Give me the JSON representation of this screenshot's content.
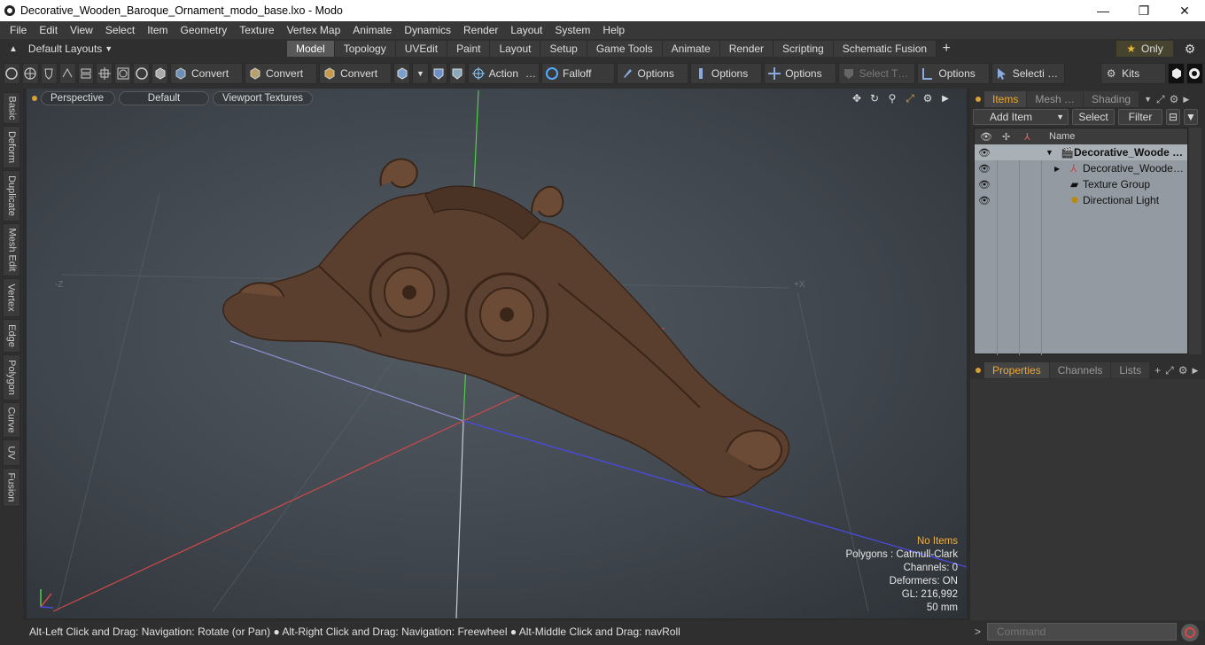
{
  "window": {
    "title": "Decorative_Wooden_Baroque_Ornament_modo_base.lxo - Modo",
    "minimize": "—",
    "maximize": "❐",
    "close": "✕"
  },
  "menu": [
    "File",
    "Edit",
    "View",
    "Select",
    "Item",
    "Geometry",
    "Texture",
    "Vertex Map",
    "Animate",
    "Dynamics",
    "Render",
    "Layout",
    "System",
    "Help"
  ],
  "layouts": {
    "label": "Default Layouts"
  },
  "tabs": [
    "Model",
    "Topology",
    "UVEdit",
    "Paint",
    "Layout",
    "Setup",
    "Game Tools",
    "Animate",
    "Render",
    "Scripting",
    "Schematic Fusion"
  ],
  "active_tab": "Model",
  "only_label": "Only",
  "toolbar": {
    "convert1": "Convert",
    "convert2": "Convert",
    "convert3": "Convert",
    "action": "Action",
    "action_more": "…",
    "falloff": "Falloff",
    "options1": "Options",
    "options2": "Options",
    "options3": "Options",
    "select_t": "Select T…",
    "options4": "Options",
    "selecti": "Selecti …",
    "kits": "Kits"
  },
  "left_tabs": [
    "Basic",
    "Deform",
    "Duplicate",
    "Mesh Edit",
    "Vertex",
    "Edge",
    "Polygon",
    "Curve",
    "UV",
    "Fusion"
  ],
  "viewport": {
    "view": "Perspective",
    "shading": "Default",
    "textures": "Viewport Textures",
    "axis_neg_z": "-Z",
    "axis_pos_x": "+X",
    "info": {
      "selection": "No Items",
      "polygons": "Polygons : Catmull-Clark",
      "channels": "Channels: 0",
      "deformers": "Deformers: ON",
      "gl": "GL: 216,992",
      "size": "50 mm"
    }
  },
  "items_panel": {
    "tabs": [
      "Items",
      "Mesh …",
      "Shading"
    ],
    "add_item": "Add Item",
    "select": "Select",
    "filter": "Filter",
    "name_header": "Name",
    "rows": [
      {
        "name": "Decorative_Woode …"
      },
      {
        "name": "Decorative_Wooden …"
      },
      {
        "name": "Texture Group"
      },
      {
        "name": "Directional Light"
      }
    ]
  },
  "props_panel": {
    "tabs": [
      "Properties",
      "Channels",
      "Lists"
    ]
  },
  "status": {
    "hint": "Alt-Left Click and Drag: Navigation: Rotate (or Pan) ● Alt-Right Click and Drag: Navigation: Freewheel ● Alt-Middle Click and Drag: navRoll",
    "command_placeholder": "Command"
  },
  "colors": {
    "accent": "#f0a830",
    "viewport_bg": "#464d54",
    "wood": "#5a3f2e",
    "x_axis": "#d04a4a",
    "y_axis": "#5ad04a",
    "z_axis": "#5a5ad8"
  }
}
